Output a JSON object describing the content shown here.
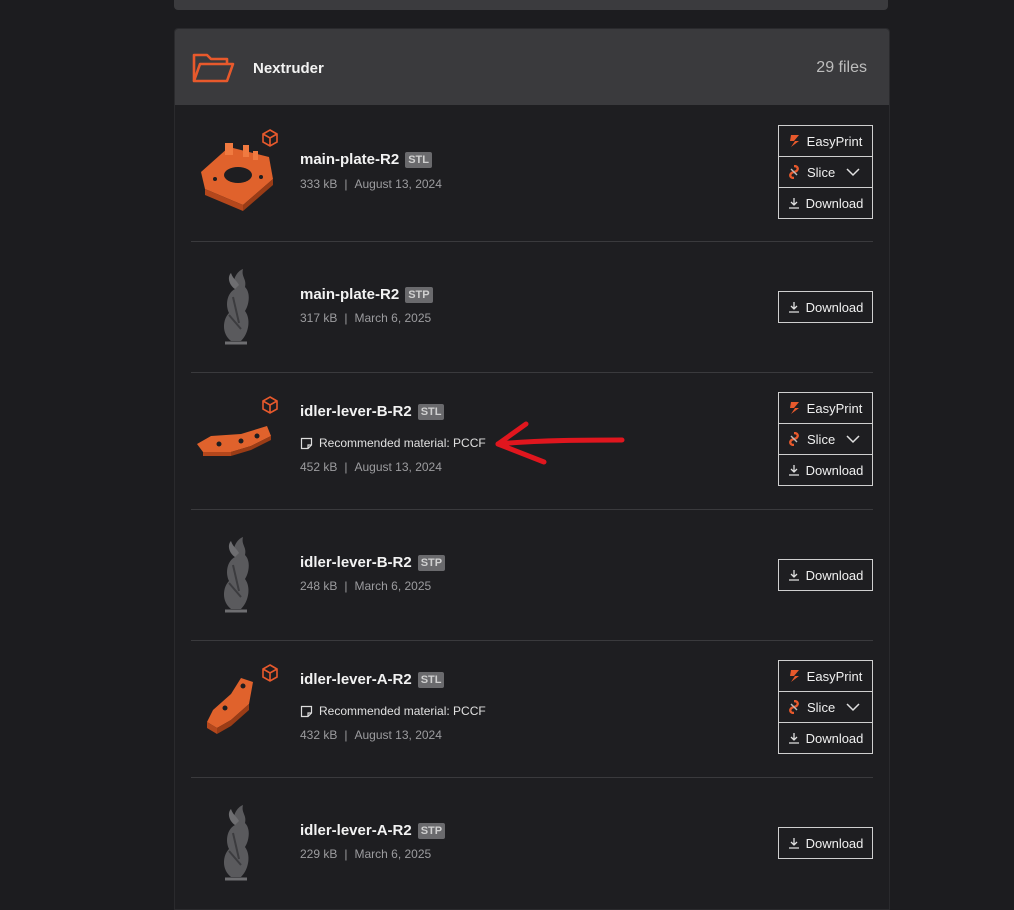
{
  "folder": {
    "title": "Nextruder",
    "count": "29 files"
  },
  "buttons": {
    "easyprint": "EasyPrint",
    "slice": "Slice",
    "download": "Download"
  },
  "files": [
    {
      "name": "main-plate-R2",
      "type": "STL",
      "size": "333 kB",
      "date": "August 13, 2024",
      "note": ""
    },
    {
      "name": "main-plate-R2",
      "type": "STP",
      "size": "317 kB",
      "date": "March 6, 2025",
      "note": ""
    },
    {
      "name": "idler-lever-B-R2",
      "type": "STL",
      "size": "452 kB",
      "date": "August 13, 2024",
      "note": "Recommended material: PCCF"
    },
    {
      "name": "idler-lever-B-R2",
      "type": "STP",
      "size": "248 kB",
      "date": "March 6, 2025",
      "note": ""
    },
    {
      "name": "idler-lever-A-R2",
      "type": "STL",
      "size": "432 kB",
      "date": "August 13, 2024",
      "note": "Recommended material: PCCF"
    },
    {
      "name": "idler-lever-A-R2",
      "type": "STP",
      "size": "229 kB",
      "date": "March 6, 2025",
      "note": ""
    }
  ],
  "colors": {
    "accent": "#e8592c",
    "annotation": "#e0161e"
  },
  "icons": [
    "folder-icon",
    "cube-icon",
    "note-icon",
    "easyprint-icon",
    "slice-icon",
    "chevron-down-icon",
    "download-icon"
  ]
}
